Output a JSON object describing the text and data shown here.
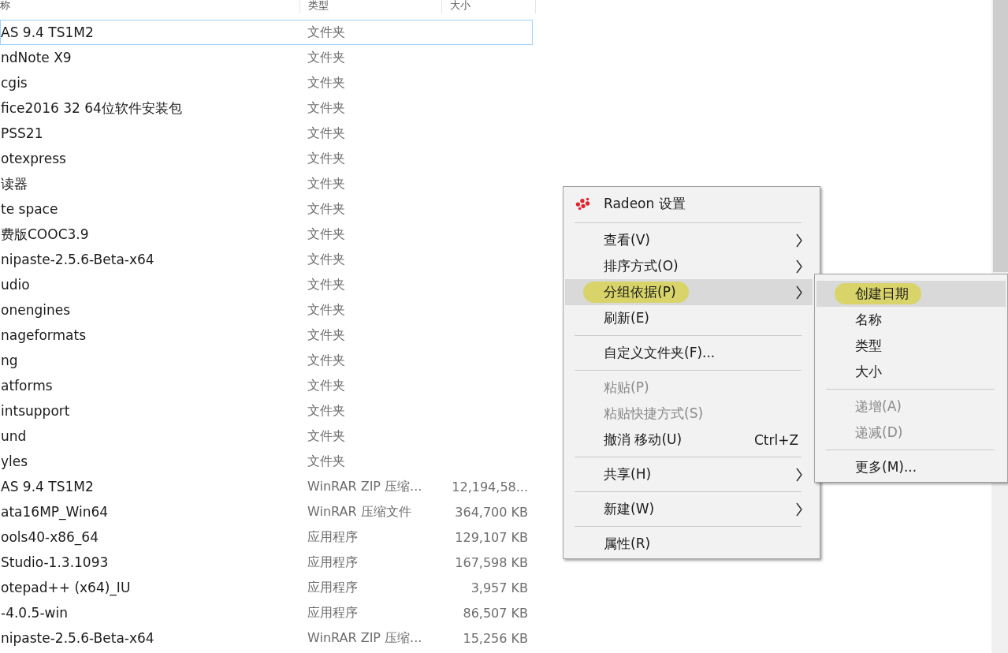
{
  "columns": [
    "称",
    "类型",
    "大小"
  ],
  "rows": [
    {
      "name": "AS 9.4 TS1M2",
      "type": "文件夹",
      "size": "",
      "selected": true
    },
    {
      "name": "ndNote X9",
      "type": "文件夹",
      "size": "",
      "selected": false
    },
    {
      "name": "cgis",
      "type": "文件夹",
      "size": "",
      "selected": false
    },
    {
      "name": "fice2016 32 64位软件安装包",
      "type": "文件夹",
      "size": "",
      "selected": false
    },
    {
      "name": "PSS21",
      "type": "文件夹",
      "size": "",
      "selected": false
    },
    {
      "name": "otexpress",
      "type": "文件夹",
      "size": "",
      "selected": false
    },
    {
      "name": "读器",
      "type": "文件夹",
      "size": "",
      "selected": false
    },
    {
      "name": "te space",
      "type": "文件夹",
      "size": "",
      "selected": false
    },
    {
      "name": "费版COOC3.9",
      "type": "文件夹",
      "size": "",
      "selected": false
    },
    {
      "name": "nipaste-2.5.6-Beta-x64",
      "type": "文件夹",
      "size": "",
      "selected": false
    },
    {
      "name": "udio",
      "type": "文件夹",
      "size": "",
      "selected": false
    },
    {
      "name": "onengines",
      "type": "文件夹",
      "size": "",
      "selected": false
    },
    {
      "name": "nageformats",
      "type": "文件夹",
      "size": "",
      "selected": false
    },
    {
      "name": "ng",
      "type": "文件夹",
      "size": "",
      "selected": false
    },
    {
      "name": "atforms",
      "type": "文件夹",
      "size": "",
      "selected": false
    },
    {
      "name": "intsupport",
      "type": "文件夹",
      "size": "",
      "selected": false
    },
    {
      "name": "und",
      "type": "文件夹",
      "size": "",
      "selected": false
    },
    {
      "name": "yles",
      "type": "文件夹",
      "size": "",
      "selected": false
    },
    {
      "name": "AS 9.4 TS1M2",
      "type": "WinRAR ZIP 压缩...",
      "size": "12,194,58...",
      "selected": false
    },
    {
      "name": "ata16MP_Win64",
      "type": "WinRAR 压缩文件",
      "size": "364,700 KB",
      "selected": false
    },
    {
      "name": "ools40-x86_64",
      "type": "应用程序",
      "size": "129,107 KB",
      "selected": false
    },
    {
      "name": "Studio-1.3.1093",
      "type": "应用程序",
      "size": "167,598 KB",
      "selected": false
    },
    {
      "name": "otepad++ (x64)_IU",
      "type": "应用程序",
      "size": "3,957 KB",
      "selected": false
    },
    {
      "name": "-4.0.5-win",
      "type": "应用程序",
      "size": "86,507 KB",
      "selected": false
    },
    {
      "name": "nipaste-2.5.6-Beta-x64",
      "type": "WinRAR ZIP 压缩...",
      "size": "15,256 KB",
      "selected": false
    }
  ],
  "context_menu": [
    {
      "kind": "app",
      "label": "Radeon 设置",
      "disabled": false,
      "selected": false,
      "highlighted": false,
      "submenu": false
    },
    {
      "kind": "separator"
    },
    {
      "kind": "item",
      "label": "查看(V)",
      "disabled": false,
      "selected": false,
      "highlighted": false,
      "submenu": true
    },
    {
      "kind": "item",
      "label": "排序方式(O)",
      "disabled": false,
      "selected": false,
      "highlighted": false,
      "submenu": true
    },
    {
      "kind": "item",
      "label": "分组依据(P)",
      "disabled": false,
      "selected": true,
      "highlighted": true,
      "submenu": true
    },
    {
      "kind": "item",
      "label": "刷新(E)",
      "disabled": false,
      "selected": false,
      "highlighted": false,
      "submenu": false
    },
    {
      "kind": "separator"
    },
    {
      "kind": "item",
      "label": "自定义文件夹(F)...",
      "disabled": false,
      "selected": false,
      "highlighted": false,
      "submenu": false
    },
    {
      "kind": "separator"
    },
    {
      "kind": "item",
      "label": "粘贴(P)",
      "disabled": true,
      "selected": false,
      "highlighted": false,
      "submenu": false
    },
    {
      "kind": "item",
      "label": "粘贴快捷方式(S)",
      "disabled": true,
      "selected": false,
      "highlighted": false,
      "submenu": false
    },
    {
      "kind": "item",
      "label": "撤消 移动(U)",
      "shortcut": "Ctrl+Z",
      "disabled": false,
      "selected": false,
      "highlighted": false,
      "submenu": false
    },
    {
      "kind": "separator"
    },
    {
      "kind": "item",
      "label": "共享(H)",
      "disabled": false,
      "selected": false,
      "highlighted": false,
      "submenu": true
    },
    {
      "kind": "separator"
    },
    {
      "kind": "item",
      "label": "新建(W)",
      "disabled": false,
      "selected": false,
      "highlighted": false,
      "submenu": true
    },
    {
      "kind": "separator"
    },
    {
      "kind": "item",
      "label": "属性(R)",
      "disabled": false,
      "selected": false,
      "highlighted": false,
      "submenu": false
    }
  ],
  "submenu": [
    {
      "kind": "item",
      "label": "创建日期",
      "disabled": false,
      "selected": true,
      "highlighted": true
    },
    {
      "kind": "item",
      "label": "名称",
      "disabled": false,
      "selected": false,
      "highlighted": false
    },
    {
      "kind": "item",
      "label": "类型",
      "disabled": false,
      "selected": false,
      "highlighted": false
    },
    {
      "kind": "item",
      "label": "大小",
      "disabled": false,
      "selected": false,
      "highlighted": false
    },
    {
      "kind": "separator"
    },
    {
      "kind": "item",
      "label": "递增(A)",
      "disabled": true,
      "selected": false,
      "highlighted": false
    },
    {
      "kind": "item",
      "label": "递减(D)",
      "disabled": true,
      "selected": false,
      "highlighted": false
    },
    {
      "kind": "separator"
    },
    {
      "kind": "item",
      "label": "更多(M)...",
      "disabled": false,
      "selected": false,
      "highlighted": false
    }
  ]
}
